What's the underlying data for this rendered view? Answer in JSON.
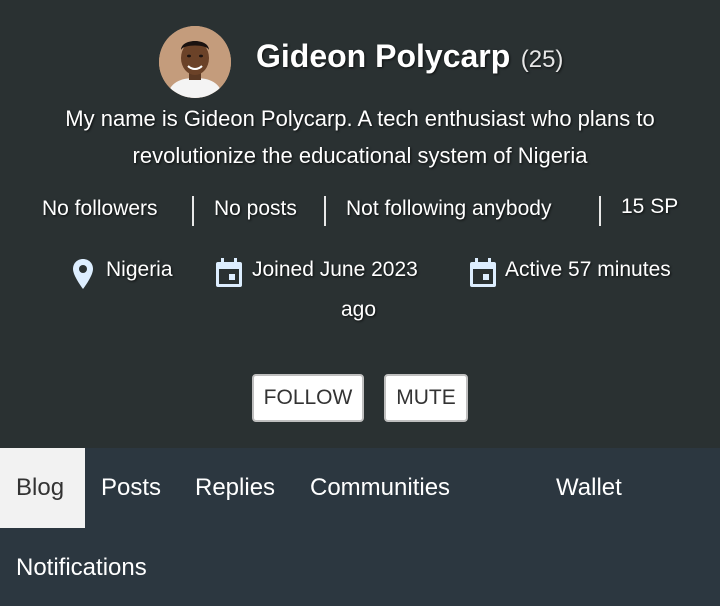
{
  "profile": {
    "name": "Gideon Polycarp",
    "reputation": "(25)",
    "about": "My name is Gideon Polycarp. A tech enthusiast who plans to revolutionize the educational system of Nigeria"
  },
  "stats": {
    "followers": "No followers",
    "posts": "No posts",
    "following": "Not following anybody",
    "sp": "15 SP"
  },
  "info": {
    "location": "Nigeria",
    "joined": "Joined June 2023",
    "active_line1": "Active 57 minutes",
    "active_line2": "ago"
  },
  "actions": {
    "follow": "FOLLOW",
    "mute": "MUTE"
  },
  "tabs": [
    {
      "label": "Blog",
      "active": true
    },
    {
      "label": "Posts"
    },
    {
      "label": "Replies"
    },
    {
      "label": "Communities"
    },
    {
      "label": "Wallet"
    },
    {
      "label": "Notifications"
    }
  ],
  "colors": {
    "header_bg": "#2a3132",
    "tabs_bg": "#2c3740",
    "active_tab_bg": "#f2f2f2",
    "icon_color": "#ddeeff"
  },
  "icons": [
    "map-marker-icon",
    "calendar-icon"
  ]
}
